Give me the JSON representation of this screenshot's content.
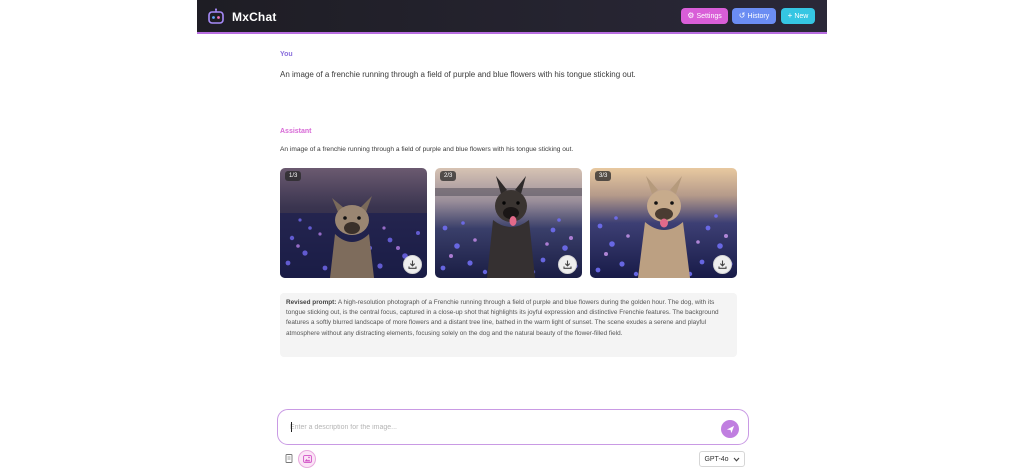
{
  "header": {
    "brand": "MxChat",
    "settings_label": "Settings",
    "history_label": "History",
    "new_label": "New"
  },
  "conversation": {
    "user_role": "You",
    "user_message": "An image of a frenchie running through a field of purple and blue flowers with his tongue sticking out.",
    "assistant_role": "Assistant",
    "assistant_message": "An image of a frenchie running through a field of purple and blue flowers with his tongue sticking out.",
    "images": [
      {
        "counter": "1/3"
      },
      {
        "counter": "2/3"
      },
      {
        "counter": "3/3"
      }
    ],
    "revised_prompt_label": "Revised prompt:",
    "revised_prompt_text": "A high-resolution photograph of a Frenchie running through a field of purple and blue flowers during the golden hour. The dog, with its tongue sticking out, is the central focus, captured in a close-up shot that highlights its joyful expression and distinctive Frenchie features. The background features a softly blurred landscape of more flowers and a distant tree line, bathed in the warm light of sunset. The scene exudes a serene and playful atmosphere without any distracting elements, focusing solely on the dog and the natural beauty of the flower-filled field."
  },
  "composer": {
    "placeholder": "Enter a description for the image...",
    "model": "GPT-4o"
  },
  "colors": {
    "header_bg": "#1e1d24",
    "settings": "#d95ed8",
    "history": "#6b8df3",
    "new": "#35c6e3",
    "accent": "#c07ee0"
  },
  "icons": [
    "chat-logo-icon",
    "gear-icon",
    "history-icon",
    "plus-icon",
    "download-icon",
    "send-icon",
    "document-icon",
    "image-icon",
    "chevron-down-icon"
  ]
}
